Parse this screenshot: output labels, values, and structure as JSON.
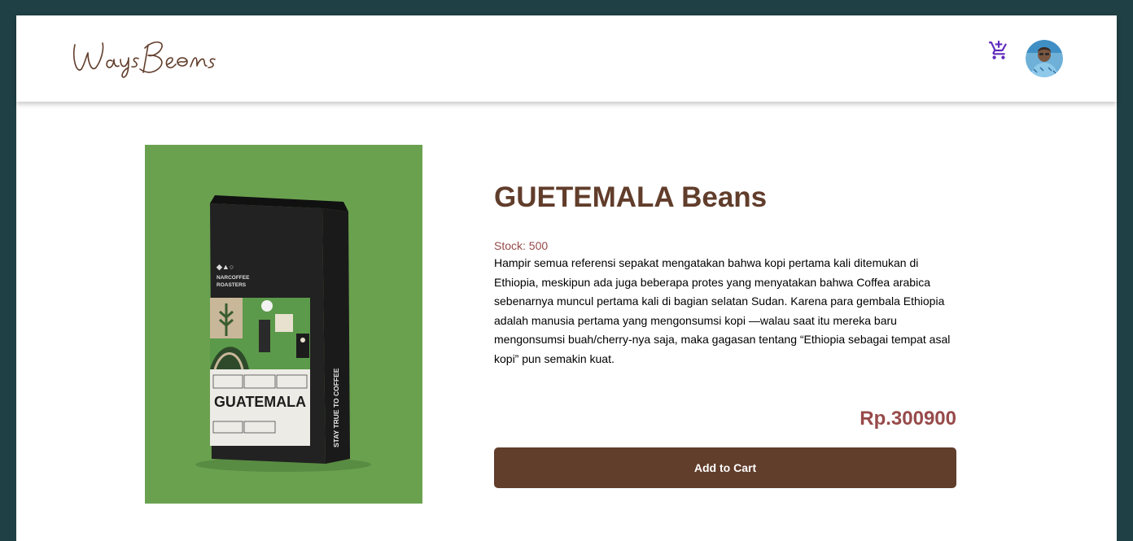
{
  "brand": {
    "logo_text": "WaysBeans"
  },
  "navbar": {
    "cart_icon": "cart-plus-icon",
    "avatar": "user-avatar"
  },
  "product": {
    "name": "GUETEMALA Beans",
    "stock": "Stock: 500",
    "description": "Hampir semua referensi sepakat mengatakan bahwa kopi pertama kali ditemukan di Ethiopia, meskipun ada juga beberapa protes yang menyatakan bahwa Coffea arabica sebenarnya muncul pertama kali di bagian selatan Sudan. Karena para gembala Ethiopia adalah manusia pertama yang mengonsumsi kopi —walau saat itu mereka baru mengonsumsi buah/cherry-nya saja, maka gagasan tentang “Ethiopia sebagai tempat asal kopi” pun semakin kuat.",
    "price": "Rp.300900",
    "add_to_cart_label": "Add to Cart",
    "image": {
      "brand_line1": "NARCOFFEE",
      "brand_line2": "ROASTERS",
      "origin": "GUATEMALA",
      "side_text": "STAY TRUE TO COFFEE"
    }
  },
  "colors": {
    "page_background": "#1f4045",
    "brand_brown": "#613d2b",
    "accent_red": "#974a4a",
    "image_green": "#6aa14f",
    "cart_icon": "#5f2bbd"
  }
}
